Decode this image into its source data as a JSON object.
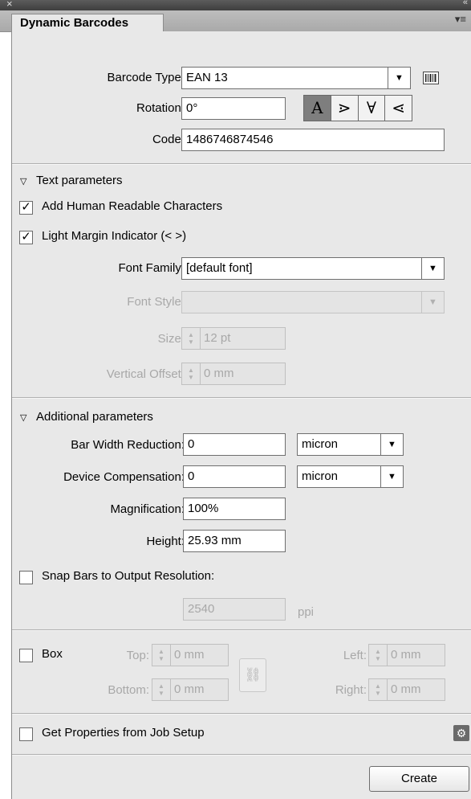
{
  "window": {
    "close_glyph": "×",
    "collapse_glyph": "«"
  },
  "tab": {
    "title": "Dynamic Barcodes"
  },
  "barcode": {
    "type_label": "Barcode Type:",
    "type_value": "EAN 13",
    "rotation_label": "Rotation:",
    "rotation_value": "0°",
    "rotation_buttons": [
      "A",
      "⋗",
      "∀",
      "⋖"
    ],
    "code_label": "Code:",
    "code_value": "1486746874546"
  },
  "text_params": {
    "section_title": "Text parameters",
    "add_human_readable": "Add Human Readable Characters",
    "light_margin": "Light Margin Indicator (< >)",
    "font_family_label": "Font Family:",
    "font_family_value": "[default font]",
    "font_style_label": "Font Style:",
    "font_style_value": "",
    "size_label": "Size:",
    "size_value": "12 pt",
    "vertical_offset_label": "Vertical Offset:",
    "vertical_offset_value": "0 mm"
  },
  "additional": {
    "section_title": "Additional parameters",
    "bar_width_label": "Bar Width Reduction:",
    "bar_width_value": "0",
    "bar_width_unit": "micron",
    "device_comp_label": "Device Compensation:",
    "device_comp_value": "0",
    "device_comp_unit": "micron",
    "magnification_label": "Magnification:",
    "magnification_value": "100%",
    "height_label": "Height:",
    "height_value": "25.93 mm",
    "snap_label": "Snap Bars to Output Resolution:",
    "resolution_value": "2540",
    "resolution_unit": "ppi"
  },
  "box": {
    "label": "Box",
    "top_label": "Top:",
    "top_value": "0 mm",
    "bottom_label": "Bottom:",
    "bottom_value": "0 mm",
    "left_label": "Left:",
    "left_value": "0 mm",
    "right_label": "Right:",
    "right_value": "0 mm"
  },
  "footer": {
    "job_setup_label": "Get Properties from Job Setup",
    "create_label": "Create"
  },
  "icons": {
    "dropdown_arrow": "▼",
    "section_triangle": "▽",
    "checkmark": "✓",
    "gear": "⚙",
    "link": "⛓",
    "menu": "▾≡",
    "stepper_up": "▲",
    "stepper_down": "▼"
  }
}
